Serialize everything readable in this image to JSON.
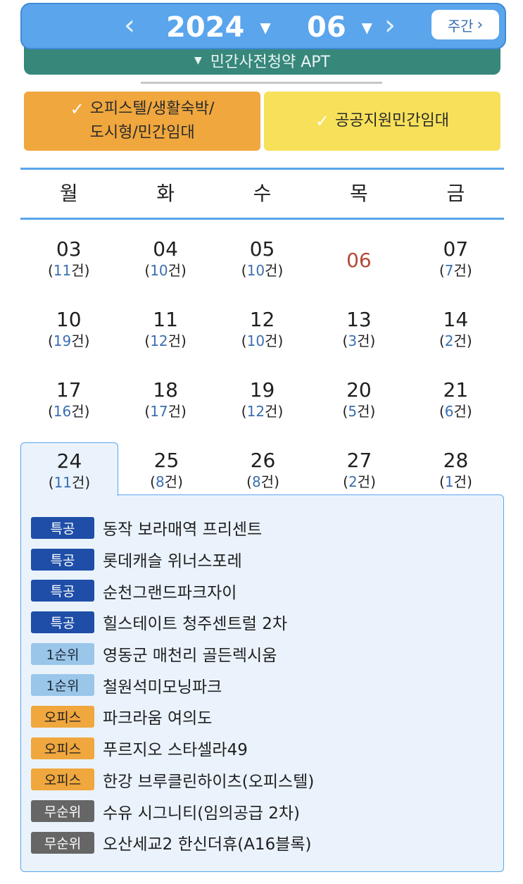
{
  "header": {
    "year": "2024",
    "month": "06",
    "prev_icon": "chevron-left-icon",
    "next_icon": "chevron-right-icon",
    "weekly_label": "주간",
    "collapsed_category": "민간사전청약 APT"
  },
  "filters": {
    "officetel_line1": "오피스텔/생활숙박/",
    "officetel_line2": "도시형/민간임대",
    "public_support": "공공지원민간임대"
  },
  "weekdays": [
    "월",
    "화",
    "수",
    "목",
    "금"
  ],
  "weeks": [
    [
      {
        "day": "03",
        "open": "(",
        "count": "11",
        "unit": "건)"
      },
      {
        "day": "04",
        "open": "(",
        "count": "10",
        "unit": "건)"
      },
      {
        "day": "05",
        "open": "(",
        "count": "10",
        "unit": "건)"
      },
      {
        "day": "06"
      },
      {
        "day": "07",
        "open": "(",
        "count": "7",
        "unit": "건)"
      }
    ],
    [
      {
        "day": "10",
        "open": "(",
        "count": "19",
        "unit": "건)"
      },
      {
        "day": "11",
        "open": "(",
        "count": "12",
        "unit": "건)"
      },
      {
        "day": "12",
        "open": "(",
        "count": "10",
        "unit": "건)"
      },
      {
        "day": "13",
        "open": "(",
        "count": "3",
        "unit": "건)"
      },
      {
        "day": "14",
        "open": "(",
        "count": "2",
        "unit": "건)"
      }
    ],
    [
      {
        "day": "17",
        "open": "(",
        "count": "16",
        "unit": "건)"
      },
      {
        "day": "18",
        "open": "(",
        "count": "17",
        "unit": "건)"
      },
      {
        "day": "19",
        "open": "(",
        "count": "12",
        "unit": "건)"
      },
      {
        "day": "20",
        "open": "(",
        "count": "5",
        "unit": "건)"
      },
      {
        "day": "21",
        "open": "(",
        "count": "6",
        "unit": "건)"
      }
    ],
    [
      {
        "day": "24",
        "open": "(",
        "count": "11",
        "unit": "건)"
      },
      {
        "day": "25",
        "open": "(",
        "count": "8",
        "unit": "건)"
      },
      {
        "day": "26",
        "open": "(",
        "count": "8",
        "unit": "건)"
      },
      {
        "day": "27",
        "open": "(",
        "count": "2",
        "unit": "건)"
      },
      {
        "day": "28",
        "open": "(",
        "count": "1",
        "unit": "건)"
      }
    ]
  ],
  "events": [
    {
      "badge": "특공",
      "name": "동작 보라매역 프리센트"
    },
    {
      "badge": "특공",
      "name": "롯데캐슬 위너스포레"
    },
    {
      "badge": "특공",
      "name": "순천그랜드파크자이"
    },
    {
      "badge": "특공",
      "name": "힐스테이트 청주센트럴 2차"
    },
    {
      "badge": "1순위",
      "name": "영동군 매천리 골든렉시움"
    },
    {
      "badge": "1순위",
      "name": "철원석미모닝파크"
    },
    {
      "badge": "오피스",
      "name": "파크라움 여의도"
    },
    {
      "badge": "오피스",
      "name": "푸르지오 스타셀라49"
    },
    {
      "badge": "오피스",
      "name": "한강 브루클린하이츠(오피스텔)"
    },
    {
      "badge": "무순위",
      "name": "수유 시그니티(임의공급 2차)"
    },
    {
      "badge": "무순위",
      "name": "오산세교2 한신더휴(A16블록)"
    }
  ],
  "colors": {
    "header_blue": "#5aa5ec",
    "collapsed_teal": "#37877b",
    "filter_orange": "#f0a73e",
    "filter_yellow": "#f7e15a",
    "today_red": "#b24a3a",
    "count_blue": "#3a6fb0",
    "badge_special": "#1e4ea7",
    "badge_first": "#9ac6ea",
    "badge_office": "#f0a73e",
    "badge_none": "#666666"
  }
}
